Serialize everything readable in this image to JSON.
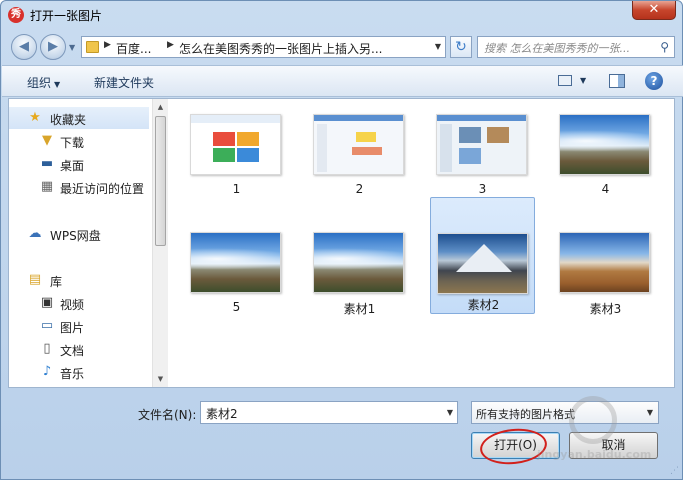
{
  "window": {
    "title": "打开一张图片"
  },
  "nav": {
    "breadcrumbs": [
      "百度...",
      "怎么在美图秀秀的一张图片上插入另..."
    ],
    "search_placeholder": "搜索 怎么在美图秀秀的一张..."
  },
  "toolbar": {
    "organize": "组织",
    "new_folder": "新建文件夹"
  },
  "sidebar": {
    "favorites": "收藏夹",
    "downloads": "下载",
    "desktop": "桌面",
    "recent": "最近访问的位置",
    "wps": "WPS网盘",
    "library": "库",
    "videos": "视频",
    "pictures": "图片",
    "documents": "文档",
    "music": "音乐"
  },
  "files": [
    {
      "name": "1",
      "kind": "screenshot"
    },
    {
      "name": "2",
      "kind": "screenshot"
    },
    {
      "name": "3",
      "kind": "screenshot"
    },
    {
      "name": "4",
      "kind": "landscape"
    },
    {
      "name": "5",
      "kind": "landscape"
    },
    {
      "name": "素材1",
      "kind": "landscape"
    },
    {
      "name": "素材2",
      "kind": "mountain",
      "selected": true
    },
    {
      "name": "素材3",
      "kind": "desert"
    }
  ],
  "footer": {
    "filename_label": "文件名(N):",
    "filename_value": "素材2",
    "filetype_value": "所有支持的图片格式",
    "open_button": "打开(O)",
    "cancel_button": "取消"
  },
  "watermark": {
    "text": "jingyan.baidu.com"
  },
  "colors": {
    "selection": "#c4dcf8",
    "annotation_circle": "#d2201b",
    "close_button": "#c7452c"
  }
}
